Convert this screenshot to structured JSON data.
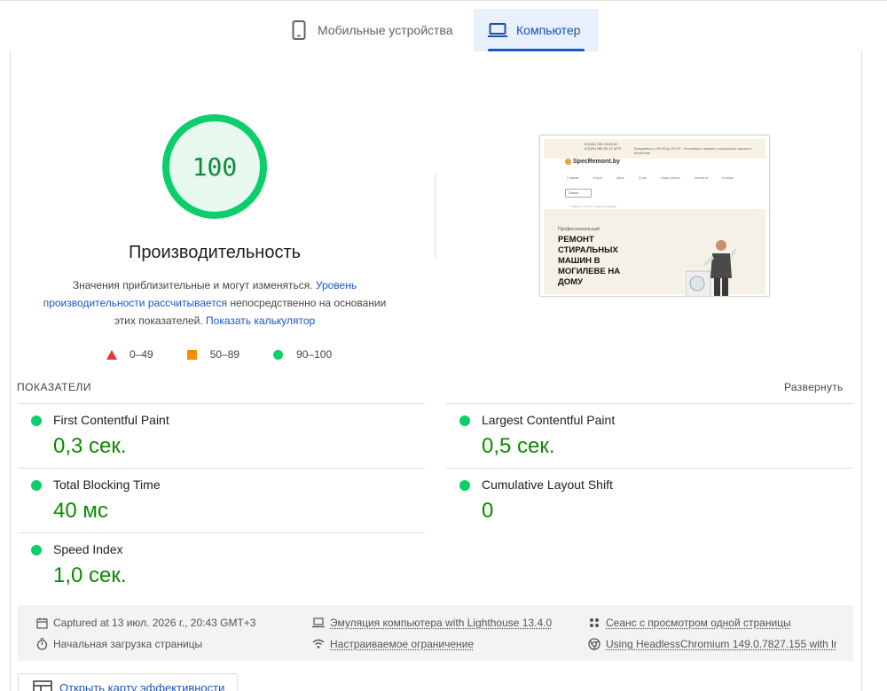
{
  "tabs": [
    {
      "label": "Мобильные устройства",
      "icon": "smartphone-icon",
      "active": false
    },
    {
      "label": "Компьютер",
      "icon": "laptop-icon",
      "active": true
    }
  ],
  "score": {
    "value": "100",
    "title": "Производительность",
    "desc_part1": "Значения приблизительные и могут изменяться. ",
    "desc_link1": "Уровень производительности рассчитывается",
    "desc_part2": " непосредственно на основании этих показателей. ",
    "desc_link2": "Показать калькулятор",
    "color": "#0cce6b"
  },
  "legend": [
    {
      "range": "0–49",
      "shape": "triangle",
      "color": "#e53935"
    },
    {
      "range": "50–89",
      "shape": "square",
      "color": "#fb8c00"
    },
    {
      "range": "90–100",
      "shape": "circle",
      "color": "#0cce6b"
    }
  ],
  "thumbnail": {
    "phone1": "8 (044) 788 78 83 A1",
    "phone2": "8 (029) 380-00-11 MTS",
    "top_note": "Ежедневно с 09:00 до 20:00 · Установка и ремонт стиральных машин в Могилеве",
    "logo": "SpecRemont.by",
    "nav": [
      "Главная",
      "Услуги",
      "Цены",
      "О нас",
      "Наши работы",
      "Контакты",
      "Отзывы"
    ],
    "search_label": "Поиск",
    "breadcrumb": "Главная › Ремонт стиральных машин",
    "pre_title": "Профессиональный",
    "headline": "РЕМОНТ\nСТИРАЛЬНЫХ\nМАШИН В\nМОГИЛЕВЕ НА\nДОМУ"
  },
  "metrics": {
    "title": "ПОКАЗАТЕЛИ",
    "expand_label": "Развернуть",
    "items": [
      {
        "name": "First Contentful Paint",
        "value": "0,3 сек.",
        "status": "good"
      },
      {
        "name": "Largest Contentful Paint",
        "value": "0,5 сек.",
        "status": "good"
      },
      {
        "name": "Total Blocking Time",
        "value": "40 мс",
        "status": "good"
      },
      {
        "name": "Cumulative Layout Shift",
        "value": "0",
        "status": "good"
      },
      {
        "name": "Speed Index",
        "value": "1,0 сек.",
        "status": "good"
      }
    ]
  },
  "run_info": {
    "captured": "Captured at 13 июл. 2026 г., 20:43 GMT+3",
    "initial_load": "Начальная загрузка страницы",
    "emulation": "Эмуляция компьютера with Lighthouse 13.4.0",
    "throttling": "Настраиваемое ограничение",
    "session": "Сеанс с просмотром одной страницы",
    "browser": "Using HeadlessChromium 149.0.7827.155 with lr"
  },
  "treemap_button": "Открыть карту эффективности"
}
